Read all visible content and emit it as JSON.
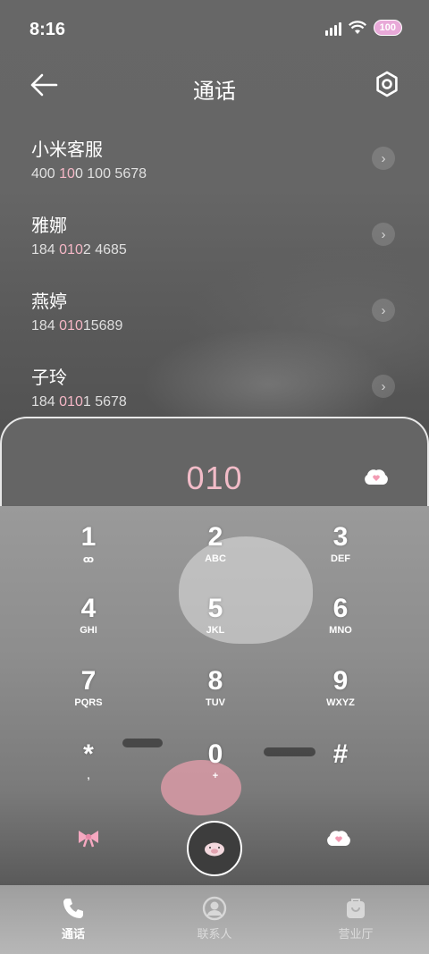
{
  "status_bar": {
    "time": "8:16",
    "battery": "100"
  },
  "header": {
    "title": "通话"
  },
  "contacts": [
    {
      "name": "小米客服",
      "number_pre": "400 ",
      "number_hl": "10",
      "number_post": "0 100 5678"
    },
    {
      "name": "雅娜",
      "number_pre": "184 ",
      "number_hl": "010",
      "number_post": "2 4685"
    },
    {
      "name": "燕婷",
      "number_pre": "184 ",
      "number_hl": "010",
      "number_post": "15689"
    },
    {
      "name": "子玲",
      "number_pre": "184 ",
      "number_hl": "010",
      "number_post": "1 5678"
    }
  ],
  "dialer": {
    "input": "010"
  },
  "keypad": [
    {
      "digit": "1",
      "letters": "ꝏ"
    },
    {
      "digit": "2",
      "letters": "ABC"
    },
    {
      "digit": "3",
      "letters": "DEF"
    },
    {
      "digit": "4",
      "letters": "GHI"
    },
    {
      "digit": "5",
      "letters": "JKL"
    },
    {
      "digit": "6",
      "letters": "MNO"
    },
    {
      "digit": "7",
      "letters": "PQRS"
    },
    {
      "digit": "8",
      "letters": "TUV"
    },
    {
      "digit": "9",
      "letters": "WXYZ"
    },
    {
      "digit": "*",
      "letters": ","
    },
    {
      "digit": "0",
      "letters": "+"
    },
    {
      "digit": "#",
      "letters": ""
    }
  ],
  "tabs": [
    {
      "label": "通话",
      "icon": "phone-icon",
      "active": true
    },
    {
      "label": "联系人",
      "icon": "person-icon",
      "active": false
    },
    {
      "label": "营业厅",
      "icon": "store-icon",
      "active": false
    }
  ],
  "colors": {
    "accent_pink": "#f2bcc8",
    "highlight_pink": "#f5b7c6"
  }
}
